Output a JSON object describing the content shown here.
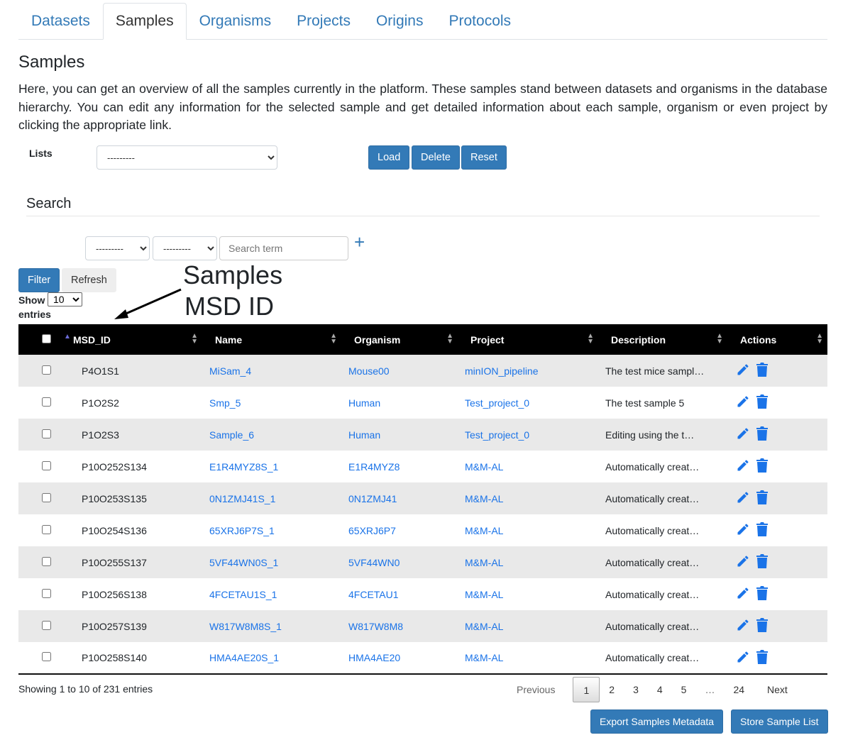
{
  "tabs": [
    {
      "label": "Datasets"
    },
    {
      "label": "Samples",
      "active": true
    },
    {
      "label": "Organisms"
    },
    {
      "label": "Projects"
    },
    {
      "label": "Origins"
    },
    {
      "label": "Protocols"
    }
  ],
  "page_title": "Samples",
  "intro": "Here, you can get an overview of all the samples currently in the platform. These samples stand between datasets and organisms in the database hierarchy. You can edit any information for the selected sample and get detailed information about each sample, organism or even project by clicking the appropriate link.",
  "lists": {
    "label": "Lists",
    "selected": "---------",
    "load": "Load",
    "delete": "Delete",
    "reset": "Reset"
  },
  "search": {
    "title": "Search",
    "field1": "---------",
    "field2": "---------",
    "placeholder": "Search term",
    "add": "+",
    "filter": "Filter",
    "refresh": "Refresh"
  },
  "annotation": {
    "line1": "Samples",
    "line2": "MSD ID"
  },
  "length": {
    "show": "Show",
    "value": "10",
    "entries": "entries"
  },
  "columns": [
    "MSD_ID",
    "Name",
    "Organism",
    "Project",
    "Description",
    "Actions"
  ],
  "rows": [
    [
      "P4O1S1",
      "MiSam_4",
      "Mouse00",
      "minION_pipeline",
      "The test mice sampl…"
    ],
    [
      "P1O2S2",
      "Smp_5",
      "Human",
      "Test_project_0",
      "The test sample 5"
    ],
    [
      "P1O2S3",
      "Sample_6",
      "Human",
      "Test_project_0",
      "Editing using the t…"
    ],
    [
      "P10O252S134",
      "E1R4MYZ8S_1",
      "E1R4MYZ8",
      "M&M-AL",
      "Automatically creat…"
    ],
    [
      "P10O253S135",
      "0N1ZMJ41S_1",
      "0N1ZMJ41",
      "M&M-AL",
      "Automatically creat…"
    ],
    [
      "P10O254S136",
      "65XRJ6P7S_1",
      "65XRJ6P7",
      "M&M-AL",
      "Automatically creat…"
    ],
    [
      "P10O255S137",
      "5VF44WN0S_1",
      "5VF44WN0",
      "M&M-AL",
      "Automatically creat…"
    ],
    [
      "P10O256S138",
      "4FCETAU1S_1",
      "4FCETAU1",
      "M&M-AL",
      "Automatically creat…"
    ],
    [
      "P10O257S139",
      "W817W8M8S_1",
      "W817W8M8",
      "M&M-AL",
      "Automatically creat…"
    ],
    [
      "P10O258S140",
      "HMA4AE20S_1",
      "HMA4AE20",
      "M&M-AL",
      "Automatically creat…"
    ]
  ],
  "info": "Showing 1 to 10 of 231 entries",
  "pager": {
    "previous": "Previous",
    "pages": [
      "1",
      "2",
      "3",
      "4",
      "5",
      "…",
      "24"
    ],
    "next": "Next"
  },
  "export": "Export Samples Metadata",
  "store": "Store Sample List",
  "colors": {
    "accent": "#337ab7",
    "link": "#1a73e8"
  }
}
